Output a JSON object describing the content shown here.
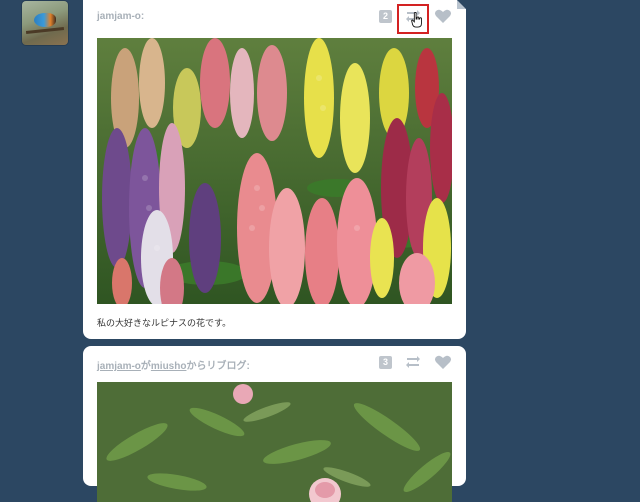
{
  "colors": {
    "background": "#2c4762",
    "card": "#ffffff",
    "meta_text": "#a8b0b8",
    "highlight": "#d32222"
  },
  "posts": [
    {
      "author": "jamjam-o:",
      "note_count": "2",
      "caption": "私の大好きなルピナスの花です。",
      "actions": {
        "reblog_icon": "reblog-icon",
        "like_icon": "heart-icon",
        "highlighted": "reblog"
      }
    },
    {
      "author": "jamjam-o",
      "reblog_connector": "が",
      "source_user": "miusho",
      "reblog_suffix": "からリブログ:",
      "note_count": "3",
      "actions": {
        "reblog_icon": "reblog-icon",
        "like_icon": "heart-icon"
      }
    }
  ]
}
